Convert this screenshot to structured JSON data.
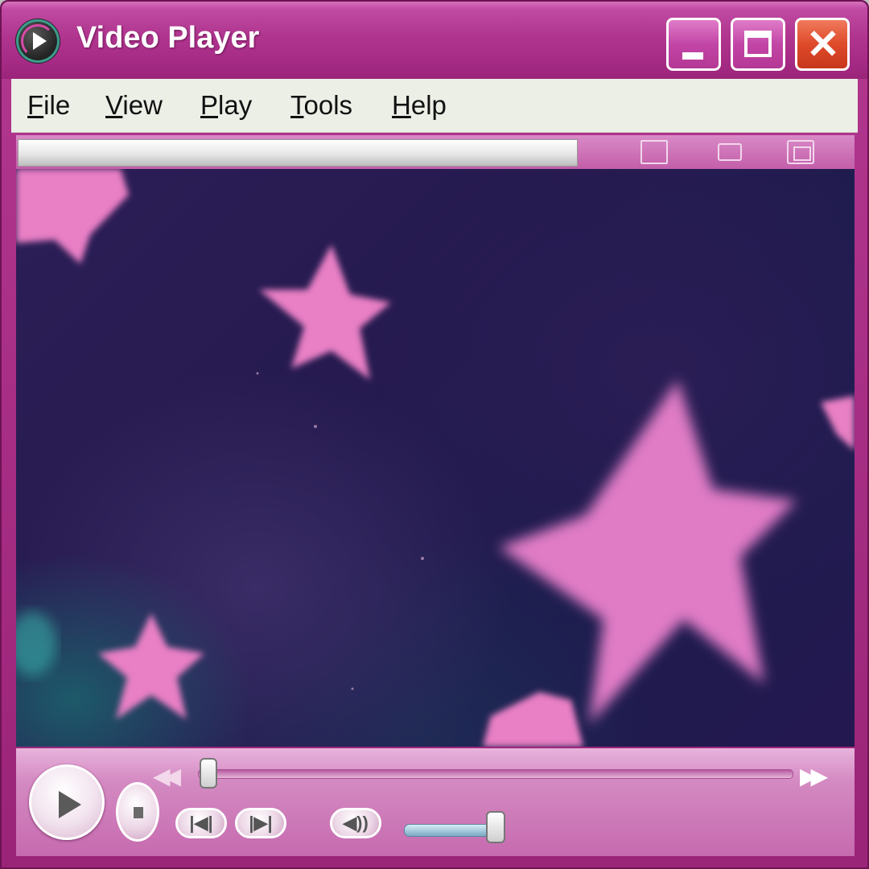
{
  "window": {
    "title": "Video Player",
    "buttons": {
      "minimize": "minimize",
      "maximize": "maximize",
      "close": "close"
    }
  },
  "menu": [
    {
      "first": "F",
      "rest": "ile"
    },
    {
      "first": "V",
      "rest": "iew"
    },
    {
      "first": "P",
      "rest": "lay"
    },
    {
      "first": "T",
      "rest": "ools"
    },
    {
      "first": "H",
      "rest": "elp"
    }
  ],
  "controls": {
    "prev_label": "|◀|",
    "next_label": "|▶|",
    "mute_label": "◀))",
    "seek_position": 0.02,
    "volume_level": 0.85
  },
  "colors": {
    "frame": "#b0358f",
    "menu_bg": "#ecefe6",
    "video_star": "#e97fc5",
    "video_bg": "#2a1d55"
  }
}
